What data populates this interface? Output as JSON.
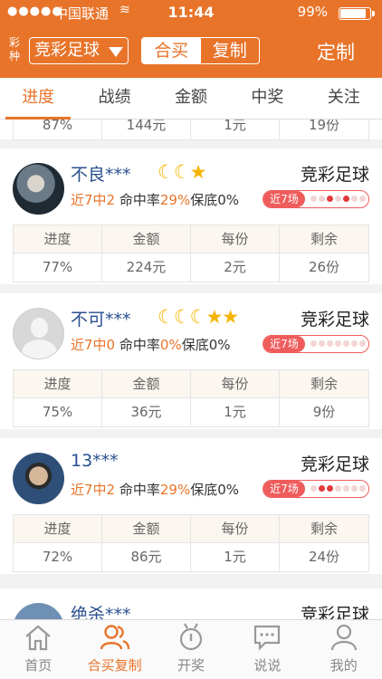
{
  "status": {
    "signal": "●●●●●",
    "carrier": "中国联通",
    "wifi": "≋",
    "time": "11:44",
    "battery": "99%"
  },
  "header": {
    "lottery_label": "彩种",
    "lottery_value": "竞彩足球",
    "seg": [
      "合买",
      "复制"
    ],
    "custom": "定制"
  },
  "tabs": [
    "进度",
    "战绩",
    "金额",
    "中奖",
    "关注"
  ],
  "partial_top": [
    "87%",
    "144元",
    "1元",
    "19份"
  ],
  "stat_headers": [
    "进度",
    "金额",
    "每份",
    "剩余"
  ],
  "cards": [
    {
      "name": "不良***",
      "rating": "☾☾★",
      "game": "竞彩足球",
      "recent_prefix": "近7中2",
      "hit_label": "命中率",
      "hit_rate": "29%",
      "guarantee": "保底0%",
      "badge": "近7场",
      "dots": [
        0,
        0,
        1,
        0,
        1,
        0,
        0
      ],
      "stats": [
        "77%",
        "224元",
        "2元",
        "26份"
      ]
    },
    {
      "name": "不可***",
      "rating": "☾☾☾★★",
      "game": "竞彩足球",
      "recent_prefix": "近7中0",
      "hit_label": "命中率",
      "hit_rate": "0%",
      "guarantee": "保底0%",
      "badge": "近7场",
      "dots": [
        0,
        0,
        0,
        0,
        0,
        0,
        0
      ],
      "stats": [
        "75%",
        "36元",
        "1元",
        "9份"
      ]
    },
    {
      "name": "13***",
      "rating": "",
      "game": "竞彩足球",
      "recent_prefix": "近7中2",
      "hit_label": "命中率",
      "hit_rate": "29%",
      "guarantee": "保底0%",
      "badge": "近7场",
      "dots": [
        0,
        1,
        1,
        0,
        0,
        0,
        0
      ],
      "stats": [
        "72%",
        "86元",
        "1元",
        "24份"
      ]
    }
  ],
  "partial_bottom": {
    "name": "绝杀***",
    "game": "竞彩足球"
  },
  "bottom_nav": [
    {
      "label": "首页",
      "icon": "home-icon"
    },
    {
      "label": "合买复制",
      "icon": "group-icon"
    },
    {
      "label": "开奖",
      "icon": "draw-icon"
    },
    {
      "label": "说说",
      "icon": "chat-icon"
    },
    {
      "label": "我的",
      "icon": "profile-icon"
    }
  ],
  "colors": {
    "brand": "#e8742a",
    "badge": "#ef5c5c",
    "name": "#2a4f8f",
    "star": "#f5b400"
  }
}
